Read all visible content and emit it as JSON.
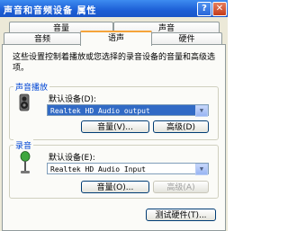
{
  "window": {
    "title": "声音和音频设备 属性",
    "help_label": "?",
    "close_label": "✕"
  },
  "tabs": {
    "row1": [
      {
        "label": "音量"
      },
      {
        "label": "声音"
      }
    ],
    "row2": [
      {
        "label": "音频"
      },
      {
        "label": "语声"
      },
      {
        "label": "硬件"
      }
    ],
    "active": "语声"
  },
  "description": "这些设置控制着播放或您选择的录音设备的音量和高级选项。",
  "playback": {
    "group_label": "声音播放",
    "device_label": "默认设备(D):",
    "device_value": "Realtek HD Audio output",
    "volume_button": "音量(V)...",
    "advanced_button": "高级(D)"
  },
  "recording": {
    "group_label": "录音",
    "device_label": "默认设备(E):",
    "device_value": "Realtek HD Audio Input",
    "volume_button": "音量(O)...",
    "advanced_button": "高级(A)"
  },
  "test_button": "测试硬件(T)...",
  "colors": {
    "titlebar": "#1d5fd6",
    "selection": "#316ac5",
    "group_label": "#0046d5"
  },
  "icons": {
    "playback": "speaker-icon",
    "recording": "microphone-icon"
  }
}
